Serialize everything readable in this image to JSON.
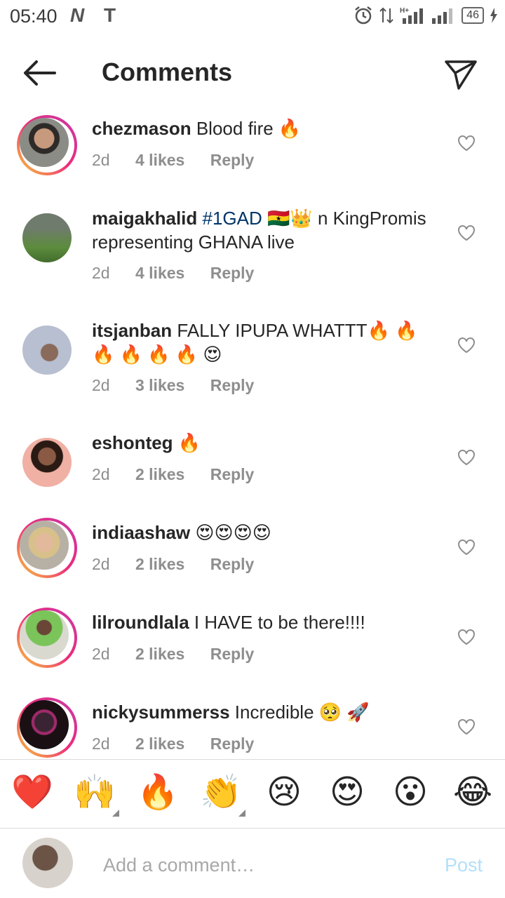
{
  "status_bar": {
    "time": "05:40",
    "n_icon": "N",
    "t_icon": "T",
    "battery": "46"
  },
  "header": {
    "title": "Comments",
    "back_icon": "back-arrow",
    "send_icon": "paper-plane"
  },
  "comments": [
    {
      "username": "chezmason",
      "text": "Blood fire 🔥",
      "age": "2d",
      "likes": "4 likes",
      "reply": "Reply",
      "ring": true
    },
    {
      "username": "maigakhalid",
      "hashtag": "#1GAD",
      "text": " 🇬🇭👑 n KingPromis representing GHANA live",
      "age": "2d",
      "likes": "4 likes",
      "reply": "Reply",
      "ring": false
    },
    {
      "username": "itsjanban",
      "text": "FALLY IPUPA WHATTT🔥 🔥 🔥 🔥 🔥 🔥 😍",
      "age": "2d",
      "likes": "3 likes",
      "reply": "Reply",
      "ring": false
    },
    {
      "username": "eshonteg",
      "text": "🔥",
      "age": "2d",
      "likes": "2 likes",
      "reply": "Reply",
      "ring": false
    },
    {
      "username": "indiaashaw",
      "text": "😍😍😍😍",
      "age": "2d",
      "likes": "2 likes",
      "reply": "Reply",
      "ring": true
    },
    {
      "username": "lilroundlala",
      "text": "I HAVE to be there!!!!",
      "age": "2d",
      "likes": "2 likes",
      "reply": "Reply",
      "ring": true
    },
    {
      "username": "nickysummerss",
      "text": "Incredible 🥺 🚀",
      "age": "2d",
      "likes": "2 likes",
      "reply": "Reply",
      "ring": true
    }
  ],
  "emoji_bar": [
    "❤️",
    "🙌",
    "🔥",
    "👏",
    "😢",
    "😍",
    "😮",
    "😂"
  ],
  "comment_box": {
    "placeholder": "Add a comment…",
    "post_label": "Post"
  },
  "colors": {
    "hashtag": "#003569",
    "post_disabled": "#b2dffc",
    "meta": "#8e8e8e"
  }
}
